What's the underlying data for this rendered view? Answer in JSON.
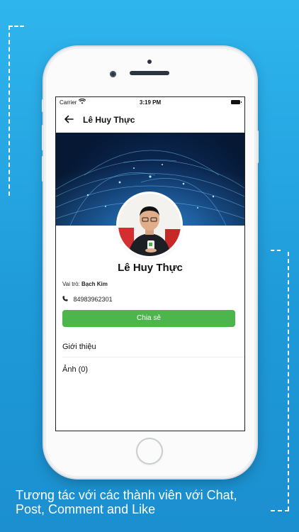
{
  "status_bar": {
    "carrier": "Carrier",
    "time": "3:19 PM"
  },
  "header": {
    "title": "Lê Huy Thực"
  },
  "profile": {
    "name": "Lê Huy Thực",
    "role_label": "Vai trò:",
    "role_value": "Bạch Kim",
    "phone": "84983962301",
    "share_label": "Chia sẻ"
  },
  "sections": {
    "intro": "Giới thiệu",
    "photos": "Ảnh (0)"
  },
  "caption": {
    "line1": "Tương tác với các thành viên với Chat,",
    "line2": "Post, Comment and Like"
  },
  "colors": {
    "accent": "#4cb54c",
    "background": "#1f9bd9"
  }
}
